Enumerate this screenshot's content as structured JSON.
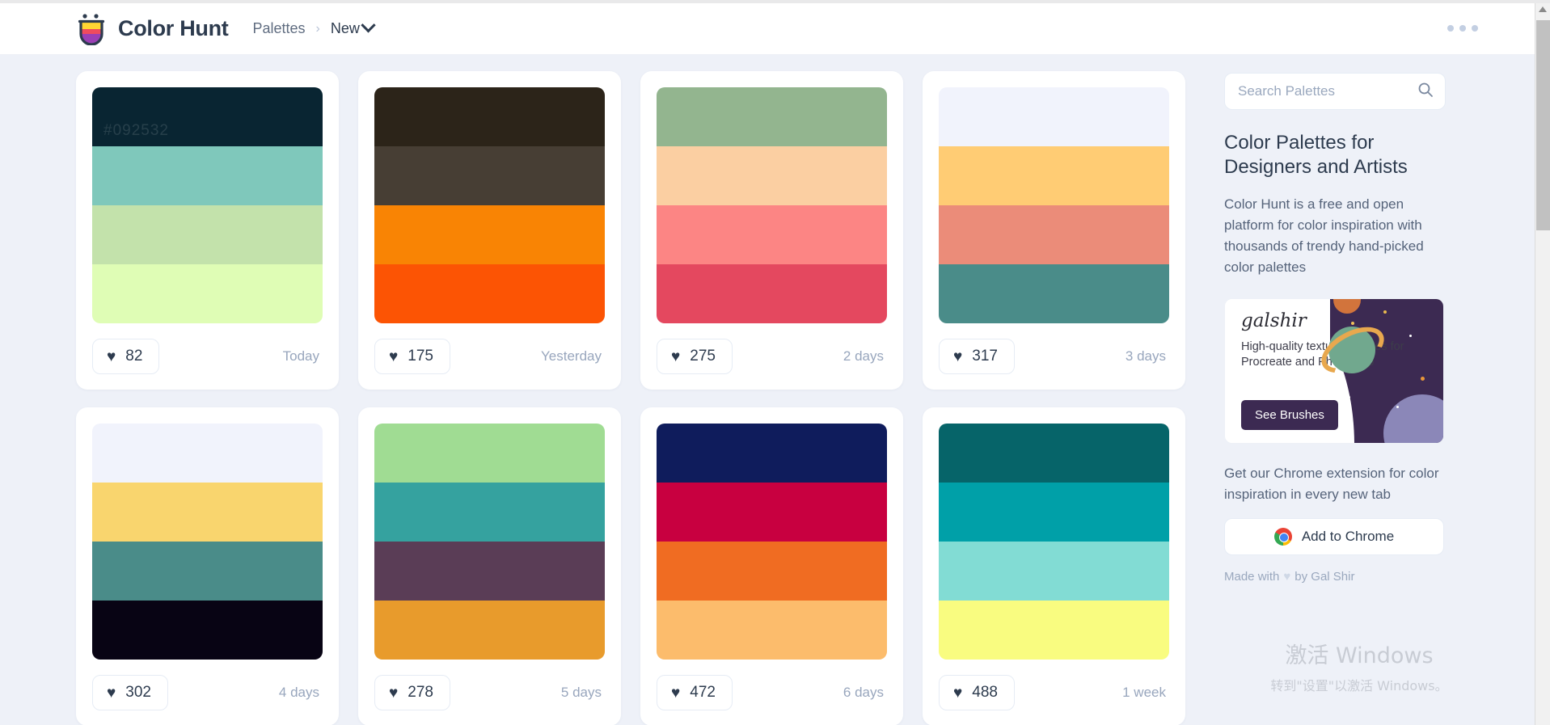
{
  "header": {
    "brand": "Color Hunt",
    "logo_icon": "colorhunt-cup-logo-icon",
    "breadcrumb_root": "Palettes",
    "breadcrumb_separator": "›",
    "breadcrumb_current": "New",
    "dropdown_icon": "chevron-down-icon",
    "overflow_icon": "more-horizontal-icon"
  },
  "sidebar": {
    "search": {
      "placeholder": "Search Palettes",
      "value": "",
      "icon": "search-icon"
    },
    "title": "Color Palettes for Designers and Artists",
    "description": "Color Hunt is a free and open platform for color inspiration with thousands of trendy hand-picked color palettes",
    "ad": {
      "logo": "galshir",
      "text": "High-quality texture brushes for Procreate and Photoshop",
      "button": "See Brushes",
      "button_color": "#3C2A52"
    },
    "chrome_text": "Get our Chrome extension for color inspiration in every new tab",
    "chrome_button": "Add to Chrome",
    "chrome_icon": "chrome-icon",
    "made_with_prefix": "Made with",
    "made_with_heart": "♥",
    "made_with_suffix": "by Gal Shir"
  },
  "watermark": {
    "line1": "激活 Windows",
    "line2": "转到\"设置\"以激活 Windows。"
  },
  "like_icon": "heart-icon",
  "palettes": [
    {
      "colors": [
        "#092532",
        "#7FC8BB",
        "#C3E2AB",
        "#DFFDB5"
      ],
      "likes": "82",
      "date": "Today",
      "hover_hex": "#092532"
    },
    {
      "colors": [
        "#2C2419",
        "#473E34",
        "#F98404",
        "#FC5404"
      ],
      "likes": "175",
      "date": "Yesterday",
      "hover_hex": ""
    },
    {
      "colors": [
        "#93B58F",
        "#FBCFA2",
        "#FC8584",
        "#E4485F"
      ],
      "likes": "275",
      "date": "2 days",
      "hover_hex": ""
    },
    {
      "colors": [
        "#F1F3FC",
        "#FFCC74",
        "#EB8C79",
        "#4A8C89"
      ],
      "likes": "317",
      "date": "3 days",
      "hover_hex": ""
    },
    {
      "colors": [
        "#F1F3FC",
        "#F9D56E",
        "#4A8C89",
        "#080414"
      ],
      "likes": "302",
      "date": "4 days",
      "hover_hex": ""
    },
    {
      "colors": [
        "#A0DC93",
        "#35A29F",
        "#5A3D56",
        "#E89B2C"
      ],
      "likes": "278",
      "date": "5 days",
      "hover_hex": ""
    },
    {
      "colors": [
        "#0F1C5C",
        "#C80040",
        "#F06C22",
        "#FCBC6C"
      ],
      "likes": "472",
      "date": "6 days",
      "hover_hex": ""
    },
    {
      "colors": [
        "#066469",
        "#00A0A8",
        "#82DCD4",
        "#F9FC80"
      ],
      "likes": "488",
      "date": "1 week",
      "hover_hex": ""
    }
  ]
}
